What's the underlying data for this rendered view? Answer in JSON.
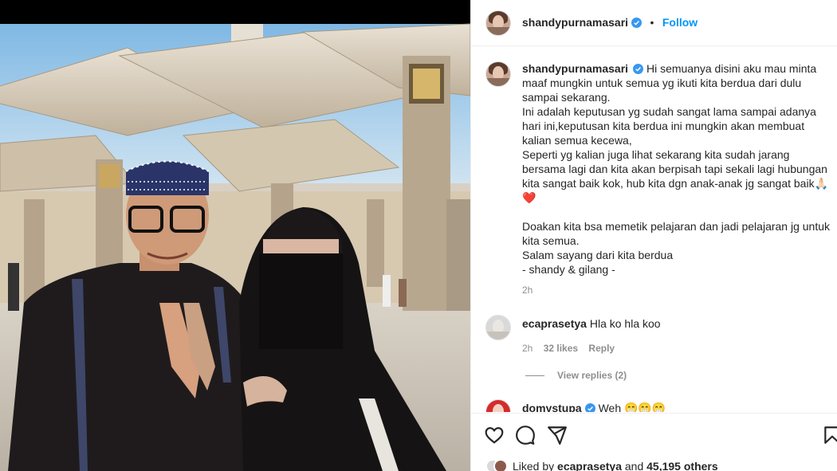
{
  "post": {
    "username": "shandypurnamasari",
    "follow_label": "Follow",
    "separator": "•",
    "more_label": "·",
    "caption_lines": [
      "Hi semuanya disini aku mau minta maaf mungkin untuk semua yg ikuti kita berdua dari dulu sampai sekarang.",
      "Ini adalah keputusan yg sudah sangat lama sampai adanya hari ini,keputusan kita berdua ini mungkin akan membuat kalian semua kecewa,",
      "Seperti yg kalian juga lihat sekarang kita sudah jarang bersama lagi dan kita akan berpisah tapi sekali lagi hubungan kita sangat baik kok, hub kita dgn anak-anak jg sangat baik🙏🏻❤️",
      "",
      "Doakan kita bsa memetik pelajaran dan jadi pelajaran jg untuk kita semua.",
      "Salam sayang dari kita berdua",
      "- shandy & gilang -"
    ],
    "caption_time": "2h"
  },
  "comments": [
    {
      "username": "ecaprasetya",
      "text": "Hla ko hla koo",
      "time": "2h",
      "likes": "32 likes",
      "reply_label": "Reply",
      "view_replies": "View replies (2)"
    },
    {
      "username": "domystupa",
      "text": "Weh 😁😁😁",
      "verified": true
    }
  ],
  "footer": {
    "liked_prefix": "Liked by",
    "liked_user": "ecaprasetya",
    "liked_and": "and",
    "liked_count": "45,195 others"
  },
  "icons": {
    "like": "heart-icon",
    "comment": "comment-icon",
    "share": "share-icon",
    "save": "bookmark-icon",
    "verified": "verified-badge-icon"
  },
  "colors": {
    "accent": "#0095f6",
    "muted": "#8e8e8e",
    "text": "#262626",
    "verified": "#3897f0"
  }
}
